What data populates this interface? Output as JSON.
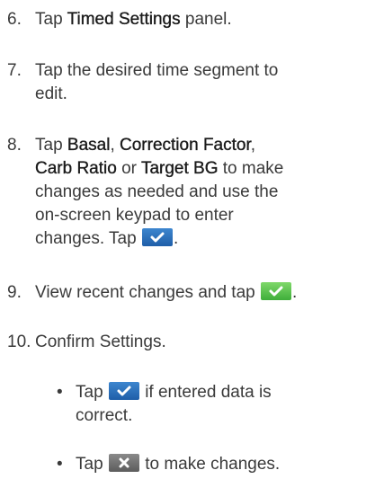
{
  "steps": [
    {
      "number": "6.",
      "lines": [
        "Tap ",
        "Timed Settings",
        " panel."
      ]
    },
    {
      "number": "7.",
      "line1": "Tap the desired time segment to",
      "line2": "edit."
    },
    {
      "number": "8.",
      "line1_a": "Tap ",
      "line1_b": "Basal",
      "line1_c": ", ",
      "line1_d": "Correction Factor",
      "line1_e": ",",
      "line2_a": "Carb Ratio",
      "line2_b": " or ",
      "line2_c": "Target BG",
      "line2_d": " to make",
      "line3": "changes as needed and use the",
      "line4": "on-screen keypad to enter",
      "line5_a": "changes. Tap ",
      "line5_b": "."
    },
    {
      "number": "9.",
      "text_a": "View recent changes and tap ",
      "text_b": "."
    },
    {
      "number": "10.",
      "text": "Confirm Settings."
    }
  ],
  "substeps": [
    {
      "bullet": "•",
      "line1_a": "Tap ",
      "line1_b": " if entered data is",
      "line2": "correct."
    },
    {
      "bullet": "•",
      "line1_a": "Tap ",
      "line1_b": " to make changes."
    }
  ],
  "icons": {
    "confirm_blue": "checkmark-icon",
    "confirm_green": "checkmark-icon",
    "cancel_gray": "x-icon"
  },
  "colors": {
    "text": "#3a3a3a",
    "button_blue": "#2a6fbd",
    "button_green": "#5cc44c",
    "button_gray": "#707070"
  }
}
